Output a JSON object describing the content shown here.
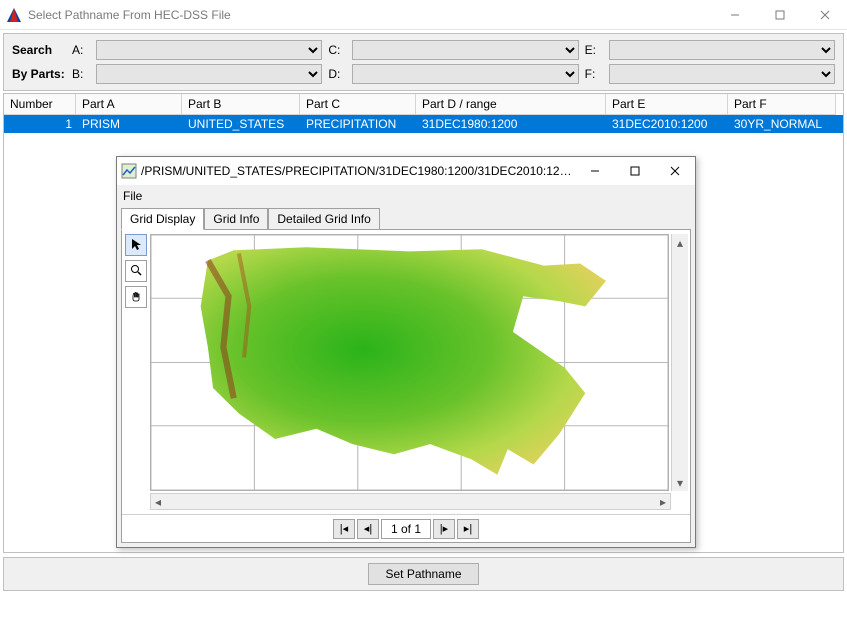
{
  "window": {
    "title": "Select Pathname From HEC-DSS File"
  },
  "search": {
    "label_search": "Search",
    "label_byparts": "By Parts:",
    "parts": {
      "A": "A:",
      "B": "B:",
      "C": "C:",
      "D": "D:",
      "E": "E:",
      "F": "F:"
    }
  },
  "table": {
    "headers": [
      "Number",
      "Part A",
      "Part B",
      "Part C",
      "Part D / range",
      "Part E",
      "Part F"
    ],
    "rows": [
      {
        "number": "1",
        "A": "PRISM",
        "B": "UNITED_STATES",
        "C": "PRECIPITATION",
        "D": "31DEC1980:1200",
        "E": "31DEC2010:1200",
        "F": "30YR_NORMAL"
      }
    ]
  },
  "viewer": {
    "title": "/PRISM/UNITED_STATES/PRECIPITATION/31DEC1980:1200/31DEC2010:1200/30...",
    "menu_file": "File",
    "tabs": [
      "Grid Display",
      "Grid Info",
      "Detailed Grid Info"
    ],
    "pager_text": "1 of 1"
  },
  "buttons": {
    "set_pathname": "Set Pathname"
  }
}
